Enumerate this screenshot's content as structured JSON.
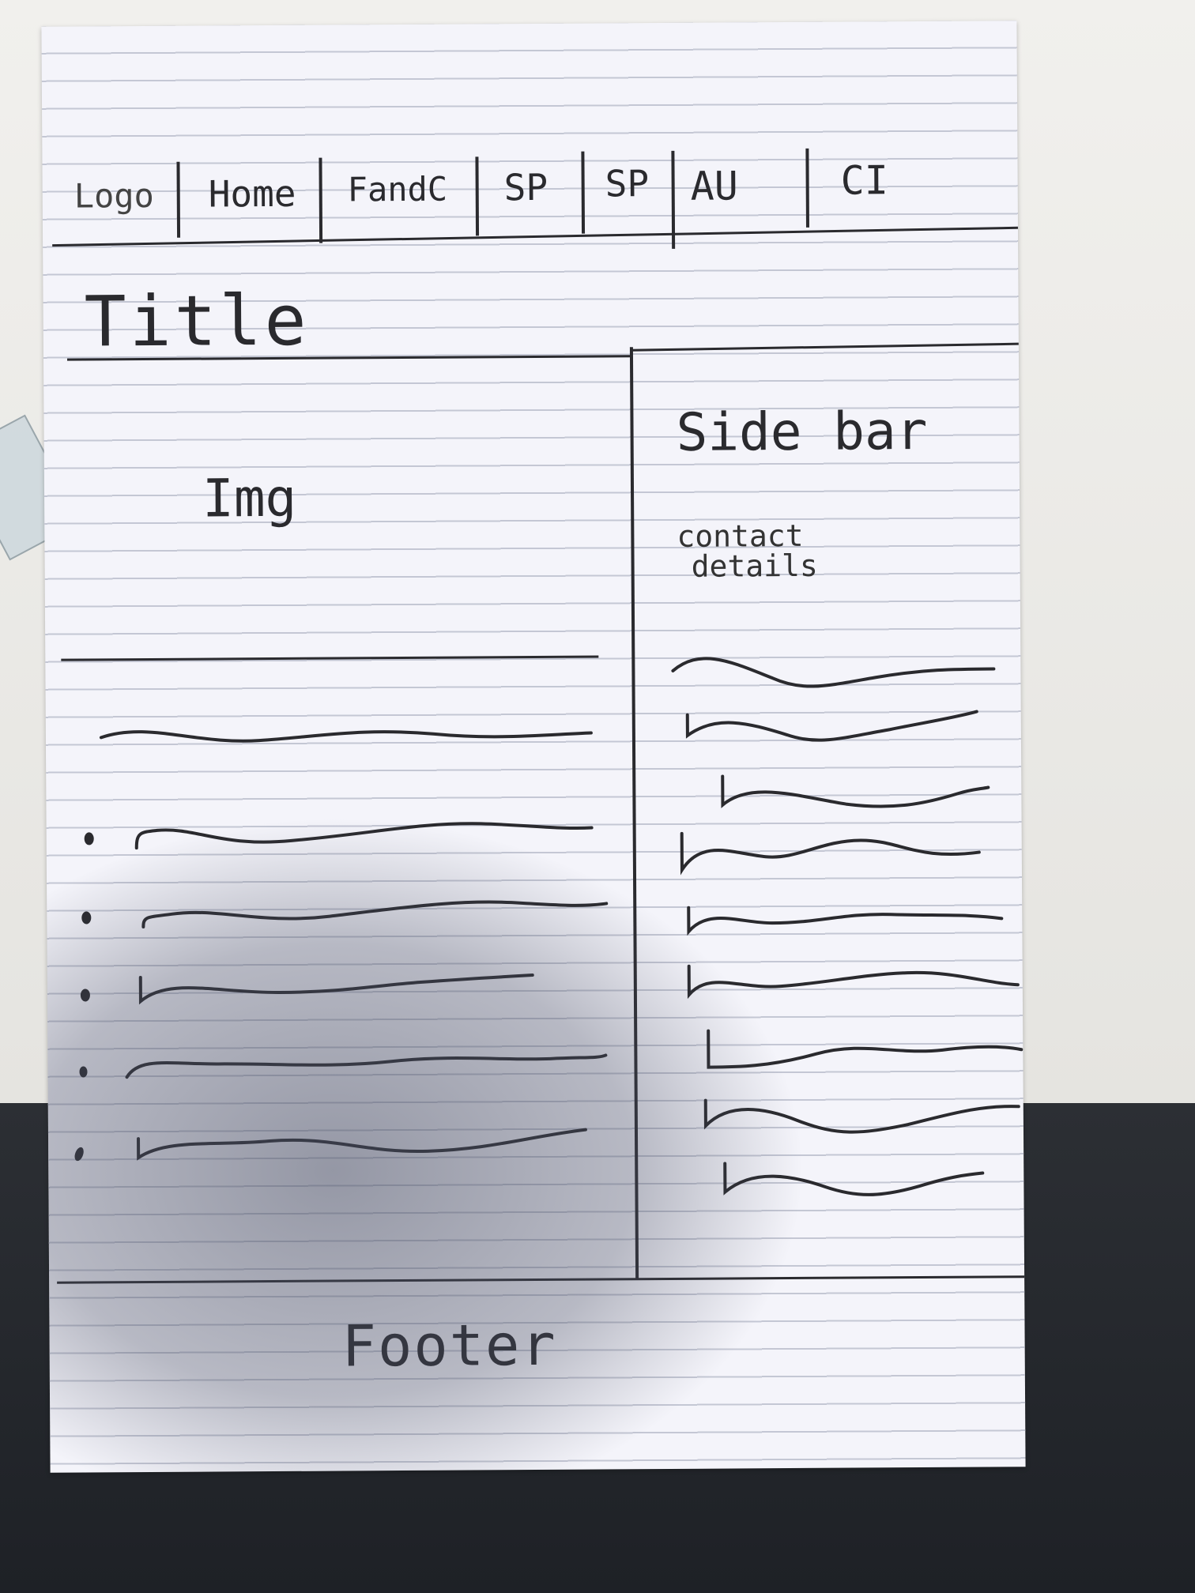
{
  "nav": {
    "logo": "Logo",
    "items": [
      "Home",
      "FandC",
      "SP",
      "SP",
      "AU",
      "CI"
    ]
  },
  "main": {
    "title": "Title",
    "image_label": "Img"
  },
  "sidebar": {
    "heading": "Side bar",
    "contact_line1": "contact",
    "contact_line2": "details"
  },
  "footer": {
    "label": "Footer"
  }
}
